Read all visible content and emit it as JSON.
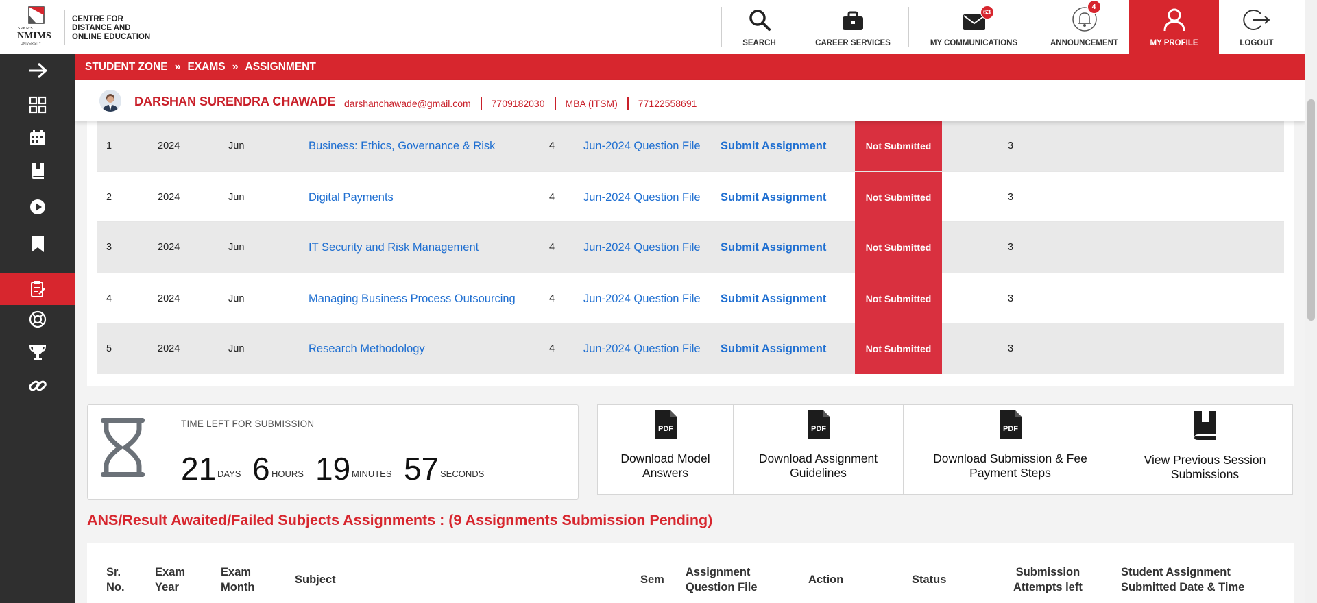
{
  "header": {
    "org_lines": [
      "CENTRE FOR",
      "DISTANCE AND",
      "ONLINE EDUCATION"
    ],
    "nav": [
      {
        "label": "SEARCH",
        "icon": "search-icon"
      },
      {
        "label": "CAREER SERVICES",
        "icon": "briefcase-icon"
      },
      {
        "label": "MY COMMUNICATIONS",
        "icon": "envelope-icon",
        "badge": "63"
      },
      {
        "label": "ANNOUNCEMENT",
        "icon": "bell-icon",
        "badge": "4"
      },
      {
        "label": "MY PROFILE",
        "icon": "user-icon",
        "active": true
      },
      {
        "label": "LOGOUT",
        "icon": "logout-icon"
      }
    ]
  },
  "breadcrumb": [
    "STUDENT ZONE",
    "EXAMS",
    "ASSIGNMENT"
  ],
  "profile": {
    "name": "DARSHAN SURENDRA CHAWADE",
    "email": "darshanchawade@gmail.com",
    "phone": "7709182030",
    "program": "MBA (ITSM)",
    "sapid": "77122558691"
  },
  "sidebar": {
    "items": [
      "arrow-right-icon",
      "dashboard-grid-icon",
      "calendar-icon",
      "book-icon",
      "play-icon",
      "bookmark-icon",
      "assignment-icon",
      "lifebuoy-icon",
      "trophy-icon",
      "link-icon"
    ],
    "active_index": 6
  },
  "assignments": [
    {
      "sr": "1",
      "year": "2024",
      "month": "Jun",
      "subject": "Business: Ethics, Governance & Risk",
      "sem": "4",
      "question_file": "Jun-2024 Question File",
      "action": "Submit Assignment",
      "status": "Not Submitted",
      "attempts": "3"
    },
    {
      "sr": "2",
      "year": "2024",
      "month": "Jun",
      "subject": "Digital Payments",
      "sem": "4",
      "question_file": "Jun-2024 Question File",
      "action": "Submit Assignment",
      "status": "Not Submitted",
      "attempts": "3"
    },
    {
      "sr": "3",
      "year": "2024",
      "month": "Jun",
      "subject": "IT Security and Risk Management",
      "sem": "4",
      "question_file": "Jun-2024 Question File",
      "action": "Submit Assignment",
      "status": "Not Submitted",
      "attempts": "3"
    },
    {
      "sr": "4",
      "year": "2024",
      "month": "Jun",
      "subject": "Managing Business Process Outsourcing",
      "sem": "4",
      "question_file": "Jun-2024 Question File",
      "action": "Submit Assignment",
      "status": "Not Submitted",
      "attempts": "3"
    },
    {
      "sr": "5",
      "year": "2024",
      "month": "Jun",
      "subject": "Research Methodology",
      "sem": "4",
      "question_file": "Jun-2024 Question File",
      "action": "Submit Assignment",
      "status": "Not Submitted",
      "attempts": "3"
    }
  ],
  "timer": {
    "title": "TIME LEFT FOR SUBMISSION",
    "days": "21",
    "days_label": "DAYS",
    "hours": "6",
    "hours_label": "HOURS",
    "minutes": "19",
    "minutes_label": "MINUTES",
    "seconds": "57",
    "seconds_label": "SECONDS"
  },
  "tiles": [
    {
      "label_lines": [
        "Download Model",
        "Answers"
      ],
      "icon": "pdf-icon"
    },
    {
      "label_lines": [
        "Download Assignment",
        "Guidelines"
      ],
      "icon": "pdf-icon"
    },
    {
      "label_lines": [
        "Download Submission & Fee",
        "Payment Steps"
      ],
      "icon": "pdf-icon"
    },
    {
      "label_lines": [
        "View Previous Session",
        "Submissions"
      ],
      "icon": "book-icon"
    }
  ],
  "pending_heading": "ANS/Result Awaited/Failed Subjects Assignments : (9 Assignments Submission Pending)",
  "pending_table_headers": [
    [
      "Sr.",
      "No."
    ],
    [
      "Exam",
      "Year"
    ],
    [
      "Exam",
      "Month"
    ],
    [
      "Subject"
    ],
    [
      "Sem"
    ],
    [
      "Assignment",
      "Question File"
    ],
    [
      "Action"
    ],
    [
      "Status"
    ],
    [
      "Submission",
      "Attempts left"
    ],
    [
      "Student Assignment",
      "Submitted Date & Time"
    ]
  ],
  "colors": {
    "brand_red": "#d7262e",
    "link_blue": "#1f6fd1",
    "sidebar": "#2f2f2f"
  }
}
